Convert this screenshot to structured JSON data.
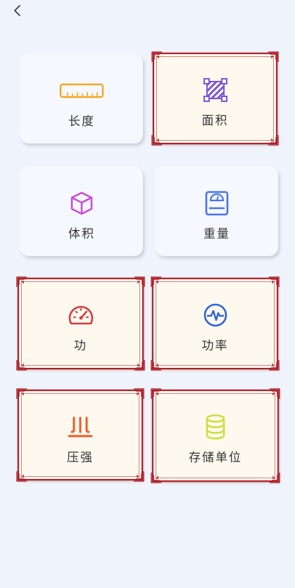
{
  "header": {
    "back_icon": "chevron-left-icon"
  },
  "colors": {
    "background": "#EFF3FC",
    "frame": "#B0222A",
    "framed_fill": "#FDF9EF",
    "plain_fill": "#F5F8FE"
  },
  "cards": [
    {
      "label": "长度",
      "icon": "ruler-icon",
      "style": "plain",
      "icon_color": "#F5A623"
    },
    {
      "label": "面积",
      "icon": "area-square-icon",
      "style": "framed",
      "icon_color": "#7B55D9"
    },
    {
      "label": "体积",
      "icon": "cube-icon",
      "style": "plain",
      "icon_color": "#C84FD8"
    },
    {
      "label": "重量",
      "icon": "scale-icon",
      "style": "plain",
      "icon_color": "#4A72E8"
    },
    {
      "label": "功",
      "icon": "speedometer-icon",
      "style": "framed",
      "icon_color": "#D93A3A"
    },
    {
      "label": "功率",
      "icon": "power-wave-icon",
      "style": "framed",
      "icon_color": "#2E62D9"
    },
    {
      "label": "压强",
      "icon": "pressure-icon",
      "style": "framed",
      "icon_color": "#F05A28"
    },
    {
      "label": "存储单位",
      "icon": "database-icon",
      "style": "framed",
      "icon_color": "#C9E03A"
    }
  ]
}
